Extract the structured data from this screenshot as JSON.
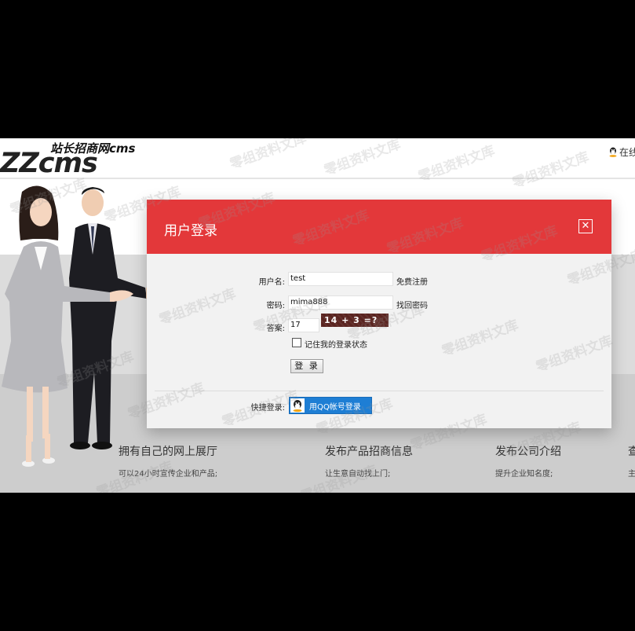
{
  "header": {
    "logo_sub": "站长招商网cms",
    "logo_main": "ZZcms",
    "online_label": "在线"
  },
  "dialog": {
    "title": "用户登录",
    "close_icon": "close-icon",
    "username_label": "用户名:",
    "username_value": "test",
    "register_link": "免费注册",
    "password_label": "密码:",
    "password_value": "mima888",
    "forgot_link": "找回密码",
    "answer_label": "答案:",
    "answer_value": "17",
    "captcha_text": "14 + 3 =?",
    "remember_label": "记住我的登录状态",
    "login_button": "登 录",
    "quick_login_label": "快捷登录:",
    "qq_login_button": "用QQ帐号登录"
  },
  "features": [
    {
      "title": "拥有自己的网上展厅",
      "desc": "可以24小时宣传企业和产品;"
    },
    {
      "title": "发布产品招商信息",
      "desc": "让生意自动找上门;"
    },
    {
      "title": "发布公司介绍",
      "desc": "提升企业知名度;"
    },
    {
      "title": "查",
      "desc": "主"
    }
  ],
  "watermark": "零组资料文库",
  "colors": {
    "header_red": "#e3383a",
    "qq_blue": "#1e7ed4",
    "captcha_bg": "#5a2420"
  }
}
